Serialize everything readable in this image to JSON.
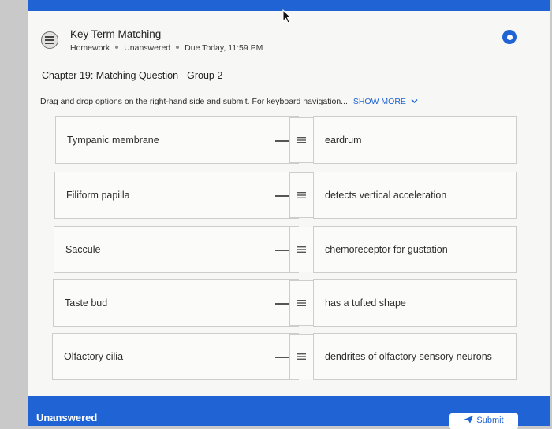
{
  "header": {
    "title": "Key Term Matching",
    "meta": [
      "Homework",
      "Unanswered",
      "Due Today, 11:59 PM"
    ]
  },
  "question": {
    "title": "Chapter 19: Matching Question - Group 2",
    "instructions": "Drag and drop options on the right-hand side and submit. For keyboard navigation...",
    "show_more": "SHOW MORE"
  },
  "pairs": [
    {
      "term": "Tympanic membrane",
      "answer": "eardrum"
    },
    {
      "term": "Filiform papilla",
      "answer": "detects vertical acceleration"
    },
    {
      "term": "Saccule",
      "answer": "chemoreceptor for gustation"
    },
    {
      "term": "Taste bud",
      "answer": "has a tufted shape"
    },
    {
      "term": "Olfactory cilia",
      "answer": "dendrites of olfactory sensory neurons"
    }
  ],
  "footer": {
    "status": "Unanswered",
    "submit_label": "Submit"
  },
  "colors": {
    "accent": "#1f63d4",
    "background": "#f7f7f5"
  }
}
